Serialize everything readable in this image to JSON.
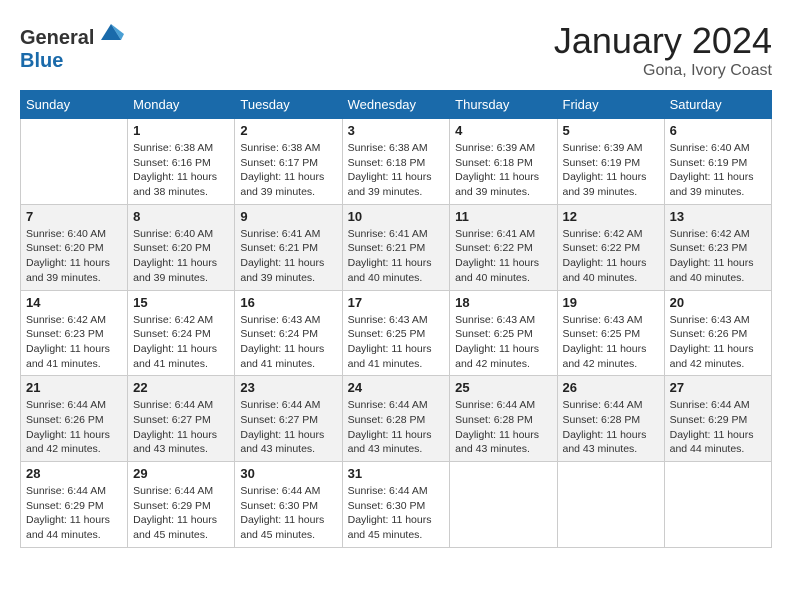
{
  "logo": {
    "text_general": "General",
    "text_blue": "Blue"
  },
  "header": {
    "month": "January 2024",
    "location": "Gona, Ivory Coast"
  },
  "columns": [
    "Sunday",
    "Monday",
    "Tuesday",
    "Wednesday",
    "Thursday",
    "Friday",
    "Saturday"
  ],
  "weeks": [
    [
      {
        "day": "",
        "sunrise": "",
        "sunset": "",
        "daylight": ""
      },
      {
        "day": "1",
        "sunrise": "Sunrise: 6:38 AM",
        "sunset": "Sunset: 6:16 PM",
        "daylight": "Daylight: 11 hours and 38 minutes."
      },
      {
        "day": "2",
        "sunrise": "Sunrise: 6:38 AM",
        "sunset": "Sunset: 6:17 PM",
        "daylight": "Daylight: 11 hours and 39 minutes."
      },
      {
        "day": "3",
        "sunrise": "Sunrise: 6:38 AM",
        "sunset": "Sunset: 6:18 PM",
        "daylight": "Daylight: 11 hours and 39 minutes."
      },
      {
        "day": "4",
        "sunrise": "Sunrise: 6:39 AM",
        "sunset": "Sunset: 6:18 PM",
        "daylight": "Daylight: 11 hours and 39 minutes."
      },
      {
        "day": "5",
        "sunrise": "Sunrise: 6:39 AM",
        "sunset": "Sunset: 6:19 PM",
        "daylight": "Daylight: 11 hours and 39 minutes."
      },
      {
        "day": "6",
        "sunrise": "Sunrise: 6:40 AM",
        "sunset": "Sunset: 6:19 PM",
        "daylight": "Daylight: 11 hours and 39 minutes."
      }
    ],
    [
      {
        "day": "7",
        "sunrise": "Sunrise: 6:40 AM",
        "sunset": "Sunset: 6:20 PM",
        "daylight": "Daylight: 11 hours and 39 minutes."
      },
      {
        "day": "8",
        "sunrise": "Sunrise: 6:40 AM",
        "sunset": "Sunset: 6:20 PM",
        "daylight": "Daylight: 11 hours and 39 minutes."
      },
      {
        "day": "9",
        "sunrise": "Sunrise: 6:41 AM",
        "sunset": "Sunset: 6:21 PM",
        "daylight": "Daylight: 11 hours and 39 minutes."
      },
      {
        "day": "10",
        "sunrise": "Sunrise: 6:41 AM",
        "sunset": "Sunset: 6:21 PM",
        "daylight": "Daylight: 11 hours and 40 minutes."
      },
      {
        "day": "11",
        "sunrise": "Sunrise: 6:41 AM",
        "sunset": "Sunset: 6:22 PM",
        "daylight": "Daylight: 11 hours and 40 minutes."
      },
      {
        "day": "12",
        "sunrise": "Sunrise: 6:42 AM",
        "sunset": "Sunset: 6:22 PM",
        "daylight": "Daylight: 11 hours and 40 minutes."
      },
      {
        "day": "13",
        "sunrise": "Sunrise: 6:42 AM",
        "sunset": "Sunset: 6:23 PM",
        "daylight": "Daylight: 11 hours and 40 minutes."
      }
    ],
    [
      {
        "day": "14",
        "sunrise": "Sunrise: 6:42 AM",
        "sunset": "Sunset: 6:23 PM",
        "daylight": "Daylight: 11 hours and 41 minutes."
      },
      {
        "day": "15",
        "sunrise": "Sunrise: 6:42 AM",
        "sunset": "Sunset: 6:24 PM",
        "daylight": "Daylight: 11 hours and 41 minutes."
      },
      {
        "day": "16",
        "sunrise": "Sunrise: 6:43 AM",
        "sunset": "Sunset: 6:24 PM",
        "daylight": "Daylight: 11 hours and 41 minutes."
      },
      {
        "day": "17",
        "sunrise": "Sunrise: 6:43 AM",
        "sunset": "Sunset: 6:25 PM",
        "daylight": "Daylight: 11 hours and 41 minutes."
      },
      {
        "day": "18",
        "sunrise": "Sunrise: 6:43 AM",
        "sunset": "Sunset: 6:25 PM",
        "daylight": "Daylight: 11 hours and 42 minutes."
      },
      {
        "day": "19",
        "sunrise": "Sunrise: 6:43 AM",
        "sunset": "Sunset: 6:25 PM",
        "daylight": "Daylight: 11 hours and 42 minutes."
      },
      {
        "day": "20",
        "sunrise": "Sunrise: 6:43 AM",
        "sunset": "Sunset: 6:26 PM",
        "daylight": "Daylight: 11 hours and 42 minutes."
      }
    ],
    [
      {
        "day": "21",
        "sunrise": "Sunrise: 6:44 AM",
        "sunset": "Sunset: 6:26 PM",
        "daylight": "Daylight: 11 hours and 42 minutes."
      },
      {
        "day": "22",
        "sunrise": "Sunrise: 6:44 AM",
        "sunset": "Sunset: 6:27 PM",
        "daylight": "Daylight: 11 hours and 43 minutes."
      },
      {
        "day": "23",
        "sunrise": "Sunrise: 6:44 AM",
        "sunset": "Sunset: 6:27 PM",
        "daylight": "Daylight: 11 hours and 43 minutes."
      },
      {
        "day": "24",
        "sunrise": "Sunrise: 6:44 AM",
        "sunset": "Sunset: 6:28 PM",
        "daylight": "Daylight: 11 hours and 43 minutes."
      },
      {
        "day": "25",
        "sunrise": "Sunrise: 6:44 AM",
        "sunset": "Sunset: 6:28 PM",
        "daylight": "Daylight: 11 hours and 43 minutes."
      },
      {
        "day": "26",
        "sunrise": "Sunrise: 6:44 AM",
        "sunset": "Sunset: 6:28 PM",
        "daylight": "Daylight: 11 hours and 43 minutes."
      },
      {
        "day": "27",
        "sunrise": "Sunrise: 6:44 AM",
        "sunset": "Sunset: 6:29 PM",
        "daylight": "Daylight: 11 hours and 44 minutes."
      }
    ],
    [
      {
        "day": "28",
        "sunrise": "Sunrise: 6:44 AM",
        "sunset": "Sunset: 6:29 PM",
        "daylight": "Daylight: 11 hours and 44 minutes."
      },
      {
        "day": "29",
        "sunrise": "Sunrise: 6:44 AM",
        "sunset": "Sunset: 6:29 PM",
        "daylight": "Daylight: 11 hours and 45 minutes."
      },
      {
        "day": "30",
        "sunrise": "Sunrise: 6:44 AM",
        "sunset": "Sunset: 6:30 PM",
        "daylight": "Daylight: 11 hours and 45 minutes."
      },
      {
        "day": "31",
        "sunrise": "Sunrise: 6:44 AM",
        "sunset": "Sunset: 6:30 PM",
        "daylight": "Daylight: 11 hours and 45 minutes."
      },
      {
        "day": "",
        "sunrise": "",
        "sunset": "",
        "daylight": ""
      },
      {
        "day": "",
        "sunrise": "",
        "sunset": "",
        "daylight": ""
      },
      {
        "day": "",
        "sunrise": "",
        "sunset": "",
        "daylight": ""
      }
    ]
  ]
}
